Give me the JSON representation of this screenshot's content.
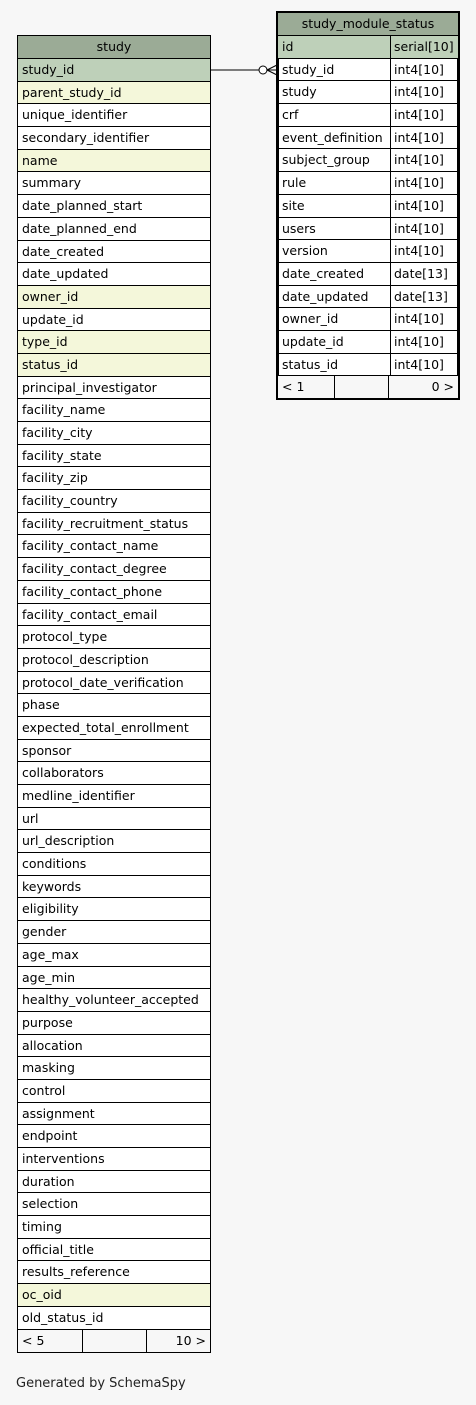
{
  "study": {
    "name": "study",
    "columns": [
      {
        "name": "study_id",
        "kind": "pk"
      },
      {
        "name": "parent_study_id",
        "kind": "fk"
      },
      {
        "name": "unique_identifier",
        "kind": ""
      },
      {
        "name": "secondary_identifier",
        "kind": ""
      },
      {
        "name": "name",
        "kind": "fk"
      },
      {
        "name": "summary",
        "kind": ""
      },
      {
        "name": "date_planned_start",
        "kind": ""
      },
      {
        "name": "date_planned_end",
        "kind": ""
      },
      {
        "name": "date_created",
        "kind": ""
      },
      {
        "name": "date_updated",
        "kind": ""
      },
      {
        "name": "owner_id",
        "kind": "fk"
      },
      {
        "name": "update_id",
        "kind": ""
      },
      {
        "name": "type_id",
        "kind": "fk"
      },
      {
        "name": "status_id",
        "kind": "fk"
      },
      {
        "name": "principal_investigator",
        "kind": ""
      },
      {
        "name": "facility_name",
        "kind": ""
      },
      {
        "name": "facility_city",
        "kind": ""
      },
      {
        "name": "facility_state",
        "kind": ""
      },
      {
        "name": "facility_zip",
        "kind": ""
      },
      {
        "name": "facility_country",
        "kind": ""
      },
      {
        "name": "facility_recruitment_status",
        "kind": ""
      },
      {
        "name": "facility_contact_name",
        "kind": ""
      },
      {
        "name": "facility_contact_degree",
        "kind": ""
      },
      {
        "name": "facility_contact_phone",
        "kind": ""
      },
      {
        "name": "facility_contact_email",
        "kind": ""
      },
      {
        "name": "protocol_type",
        "kind": ""
      },
      {
        "name": "protocol_description",
        "kind": ""
      },
      {
        "name": "protocol_date_verification",
        "kind": ""
      },
      {
        "name": "phase",
        "kind": ""
      },
      {
        "name": "expected_total_enrollment",
        "kind": ""
      },
      {
        "name": "sponsor",
        "kind": ""
      },
      {
        "name": "collaborators",
        "kind": ""
      },
      {
        "name": "medline_identifier",
        "kind": ""
      },
      {
        "name": "url",
        "kind": ""
      },
      {
        "name": "url_description",
        "kind": ""
      },
      {
        "name": "conditions",
        "kind": ""
      },
      {
        "name": "keywords",
        "kind": ""
      },
      {
        "name": "eligibility",
        "kind": ""
      },
      {
        "name": "gender",
        "kind": ""
      },
      {
        "name": "age_max",
        "kind": ""
      },
      {
        "name": "age_min",
        "kind": ""
      },
      {
        "name": "healthy_volunteer_accepted",
        "kind": ""
      },
      {
        "name": "purpose",
        "kind": ""
      },
      {
        "name": "allocation",
        "kind": ""
      },
      {
        "name": "masking",
        "kind": ""
      },
      {
        "name": "control",
        "kind": ""
      },
      {
        "name": "assignment",
        "kind": ""
      },
      {
        "name": "endpoint",
        "kind": ""
      },
      {
        "name": "interventions",
        "kind": ""
      },
      {
        "name": "duration",
        "kind": ""
      },
      {
        "name": "selection",
        "kind": ""
      },
      {
        "name": "timing",
        "kind": ""
      },
      {
        "name": "official_title",
        "kind": ""
      },
      {
        "name": "results_reference",
        "kind": ""
      },
      {
        "name": "oc_oid",
        "kind": "fk"
      },
      {
        "name": "old_status_id",
        "kind": ""
      }
    ],
    "footer": [
      "< 5",
      "",
      "10 >"
    ]
  },
  "study_module_status": {
    "name": "study_module_status",
    "columns": [
      {
        "name": "id",
        "type": "serial[10]",
        "kind": "pk"
      },
      {
        "name": "study_id",
        "type": "int4[10]",
        "kind": ""
      },
      {
        "name": "study",
        "type": "int4[10]",
        "kind": ""
      },
      {
        "name": "crf",
        "type": "int4[10]",
        "kind": ""
      },
      {
        "name": "event_definition",
        "type": "int4[10]",
        "kind": ""
      },
      {
        "name": "subject_group",
        "type": "int4[10]",
        "kind": ""
      },
      {
        "name": "rule",
        "type": "int4[10]",
        "kind": ""
      },
      {
        "name": "site",
        "type": "int4[10]",
        "kind": ""
      },
      {
        "name": "users",
        "type": "int4[10]",
        "kind": ""
      },
      {
        "name": "version",
        "type": "int4[10]",
        "kind": ""
      },
      {
        "name": "date_created",
        "type": "date[13]",
        "kind": ""
      },
      {
        "name": "date_updated",
        "type": "date[13]",
        "kind": ""
      },
      {
        "name": "owner_id",
        "type": "int4[10]",
        "kind": ""
      },
      {
        "name": "update_id",
        "type": "int4[10]",
        "kind": ""
      },
      {
        "name": "status_id",
        "type": "int4[10]",
        "kind": ""
      }
    ],
    "footer": [
      "< 1",
      "",
      "0 >"
    ]
  },
  "relationship": {
    "from": "study.study_id",
    "to": "study_module_status.study_id"
  },
  "credit": "Generated by SchemaSpy",
  "colors": {
    "header": "#9bab96",
    "primary_key": "#bed0b9",
    "foreign_key": "#f4f7da",
    "background": "#f7f7f7"
  }
}
